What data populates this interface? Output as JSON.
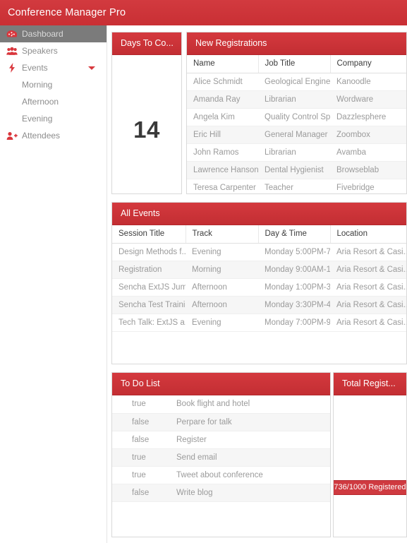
{
  "app": {
    "title": "Conference Manager Pro",
    "accent_color": "#cf3339",
    "accent_dark": "#b3272c",
    "sidebar_selected_bg": "#7b7b7b"
  },
  "sidebar": {
    "items": [
      {
        "label": "Dashboard",
        "icon": "dashboard-gauge-icon",
        "selected": true,
        "level": 0,
        "caret": false
      },
      {
        "label": "Speakers",
        "icon": "users-group-icon",
        "selected": false,
        "level": 0,
        "caret": false
      },
      {
        "label": "Events",
        "icon": "lightning-bolt-icon",
        "selected": false,
        "level": 0,
        "caret": true
      },
      {
        "label": "Morning",
        "icon": "",
        "selected": false,
        "level": 1,
        "caret": false
      },
      {
        "label": "Afternoon",
        "icon": "",
        "selected": false,
        "level": 1,
        "caret": false
      },
      {
        "label": "Evening",
        "icon": "",
        "selected": false,
        "level": 1,
        "caret": false
      },
      {
        "label": "Attendees",
        "icon": "user-plus-icon",
        "selected": false,
        "level": 0,
        "caret": false
      }
    ]
  },
  "panels": {
    "countdown": {
      "title": "Days To Co...",
      "value": "14"
    },
    "new_registrations": {
      "title": "New Registrations",
      "columns": [
        "Name",
        "Job Title",
        "Company"
      ],
      "rows": [
        [
          "Alice Schmidt",
          "Geological Engineer",
          "Kanoodle"
        ],
        [
          "Amanda Ray",
          "Librarian",
          "Wordware"
        ],
        [
          "Angela Kim",
          "Quality Control Sp...",
          "Dazzlesphere"
        ],
        [
          "Eric Hill",
          "General Manager",
          "Zoombox"
        ],
        [
          "John Ramos",
          "Librarian",
          "Avamba"
        ],
        [
          "Lawrence Hanson",
          "Dental Hygienist",
          "Browseblab"
        ],
        [
          "Teresa Carpenter",
          "Teacher",
          "Fivebridge"
        ]
      ]
    },
    "all_events": {
      "title": "All Events",
      "columns": [
        "Session Title",
        "Track",
        "Day & Time",
        "Location"
      ],
      "rows": [
        [
          "Design Methods f...",
          "Evening",
          "Monday 5:00PM-7...",
          "Aria Resort & Casi..."
        ],
        [
          "Registration",
          "Morning",
          "Monday 9:00AM-1...",
          "Aria Resort & Casi..."
        ],
        [
          "Sencha ExtJS Jum...",
          "Afternoon",
          "Monday 1:00PM-3...",
          "Aria Resort & Casi..."
        ],
        [
          "Sencha Test Traini...",
          "Afternoon",
          "Monday 3:30PM-4...",
          "Aria Resort & Casi..."
        ],
        [
          "Tech Talk: ExtJS a...",
          "Evening",
          "Monday 7:00PM-9...",
          "Aria Resort & Casi..."
        ]
      ]
    },
    "todo_list": {
      "title": "To Do List",
      "rows": [
        [
          "true",
          "Book flight and hotel"
        ],
        [
          "false",
          "Perpare for talk"
        ],
        [
          "false",
          "Register"
        ],
        [
          "true",
          "Send email"
        ],
        [
          "true",
          "Tweet about conference"
        ],
        [
          "false",
          "Write blog"
        ]
      ]
    },
    "total_registrations": {
      "title": "Total Regist...",
      "bar_label": "736/1000 Registered"
    }
  }
}
